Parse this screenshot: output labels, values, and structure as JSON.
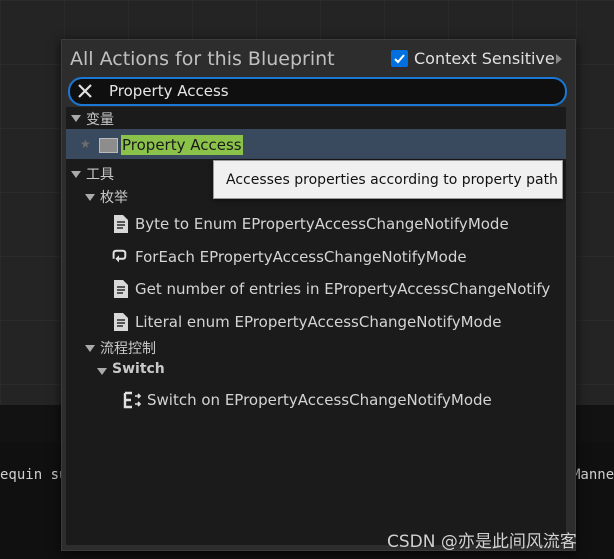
{
  "background": {
    "left_text": "equin su",
    "right_text": "Manne"
  },
  "popup": {
    "title": "All Actions for this Blueprint",
    "context_sensitive": {
      "label": "Context Sensitive",
      "checked": true
    }
  },
  "search": {
    "value": "Property Access"
  },
  "tree": {
    "cat_variables": "变量",
    "var_item": "Property Access",
    "cat_tools": "工具",
    "cat_enum": "枚举",
    "enum_items": [
      "Byte to Enum EPropertyAccessChangeNotifyMode",
      "ForEach EPropertyAccessChangeNotifyMode",
      "Get number of entries in EPropertyAccessChangeNotify",
      "Literal enum EPropertyAccessChangeNotifyMode"
    ],
    "cat_flow": "流程控制",
    "cat_switch": "Switch",
    "switch_item": "Switch on EPropertyAccessChangeNotifyMode"
  },
  "tooltip": {
    "text": "Accesses properties according to property path"
  },
  "watermark": "CSDN @亦是此间风流客",
  "colors": {
    "accent": "#1a77d4",
    "highlight": "#8bc34a",
    "selected_row": "#3a4a5e"
  }
}
